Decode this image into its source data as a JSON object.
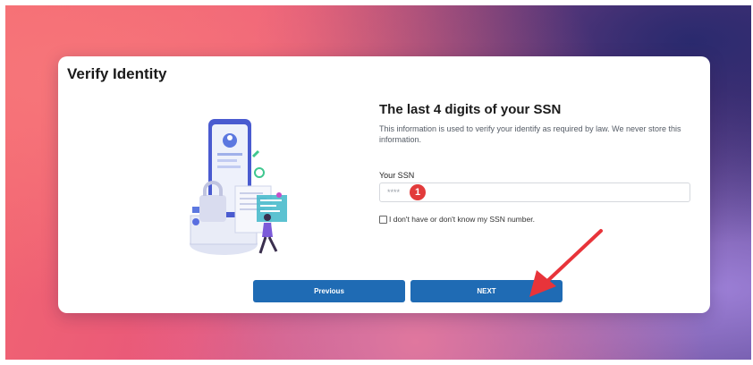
{
  "card": {
    "title": "Verify Identity"
  },
  "form": {
    "heading": "The last 4 digits of your SSN",
    "description": "This information is used to verify your identify as required by law. We never store this information.",
    "ssn_label": "Your SSN",
    "ssn_placeholder": "****",
    "ssn_value": "",
    "checkbox_label": "I don't have or don't know my SSN number.",
    "checkbox_checked": false
  },
  "annotation": {
    "step_number": "1"
  },
  "buttons": {
    "previous_label": "Previous",
    "next_label": "NEXT"
  },
  "colors": {
    "primary_button": "#1f6bb4",
    "annotation_red": "#e23b3b",
    "background_gradient": [
      "#f4686f",
      "#e8577a",
      "#a24a8e",
      "#3b2d74"
    ]
  },
  "icons": [
    "identity-verification-illustration",
    "annotation-arrow-icon"
  ]
}
